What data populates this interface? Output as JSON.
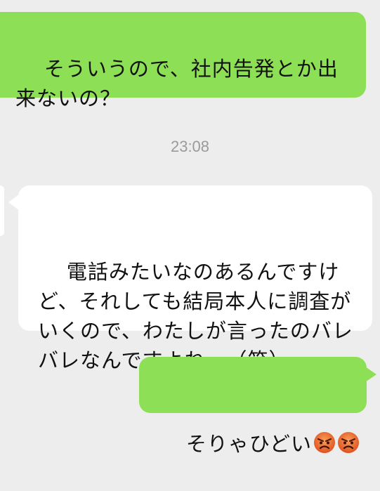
{
  "conversation": {
    "timestamp": "23:08",
    "messages": [
      {
        "sender": "self",
        "text": "そういうので、社内告発とか出来ないの？"
      },
      {
        "sender": "other",
        "text": "電話みたいなのあるんですけど、それしても結局本人に調査がいくので、わたしが言ったのバレバレなんですよね…（笑）"
      },
      {
        "sender": "self",
        "text": "そりゃひどい",
        "emojis": [
          "angry-face-icon",
          "angry-face-icon"
        ]
      }
    ]
  },
  "colors": {
    "background": "#ededed",
    "outgoing_bubble": "#8de055",
    "incoming_bubble": "#ffffff",
    "timestamp_text": "#9a9a9a",
    "emoji_face": "#e8662b"
  }
}
